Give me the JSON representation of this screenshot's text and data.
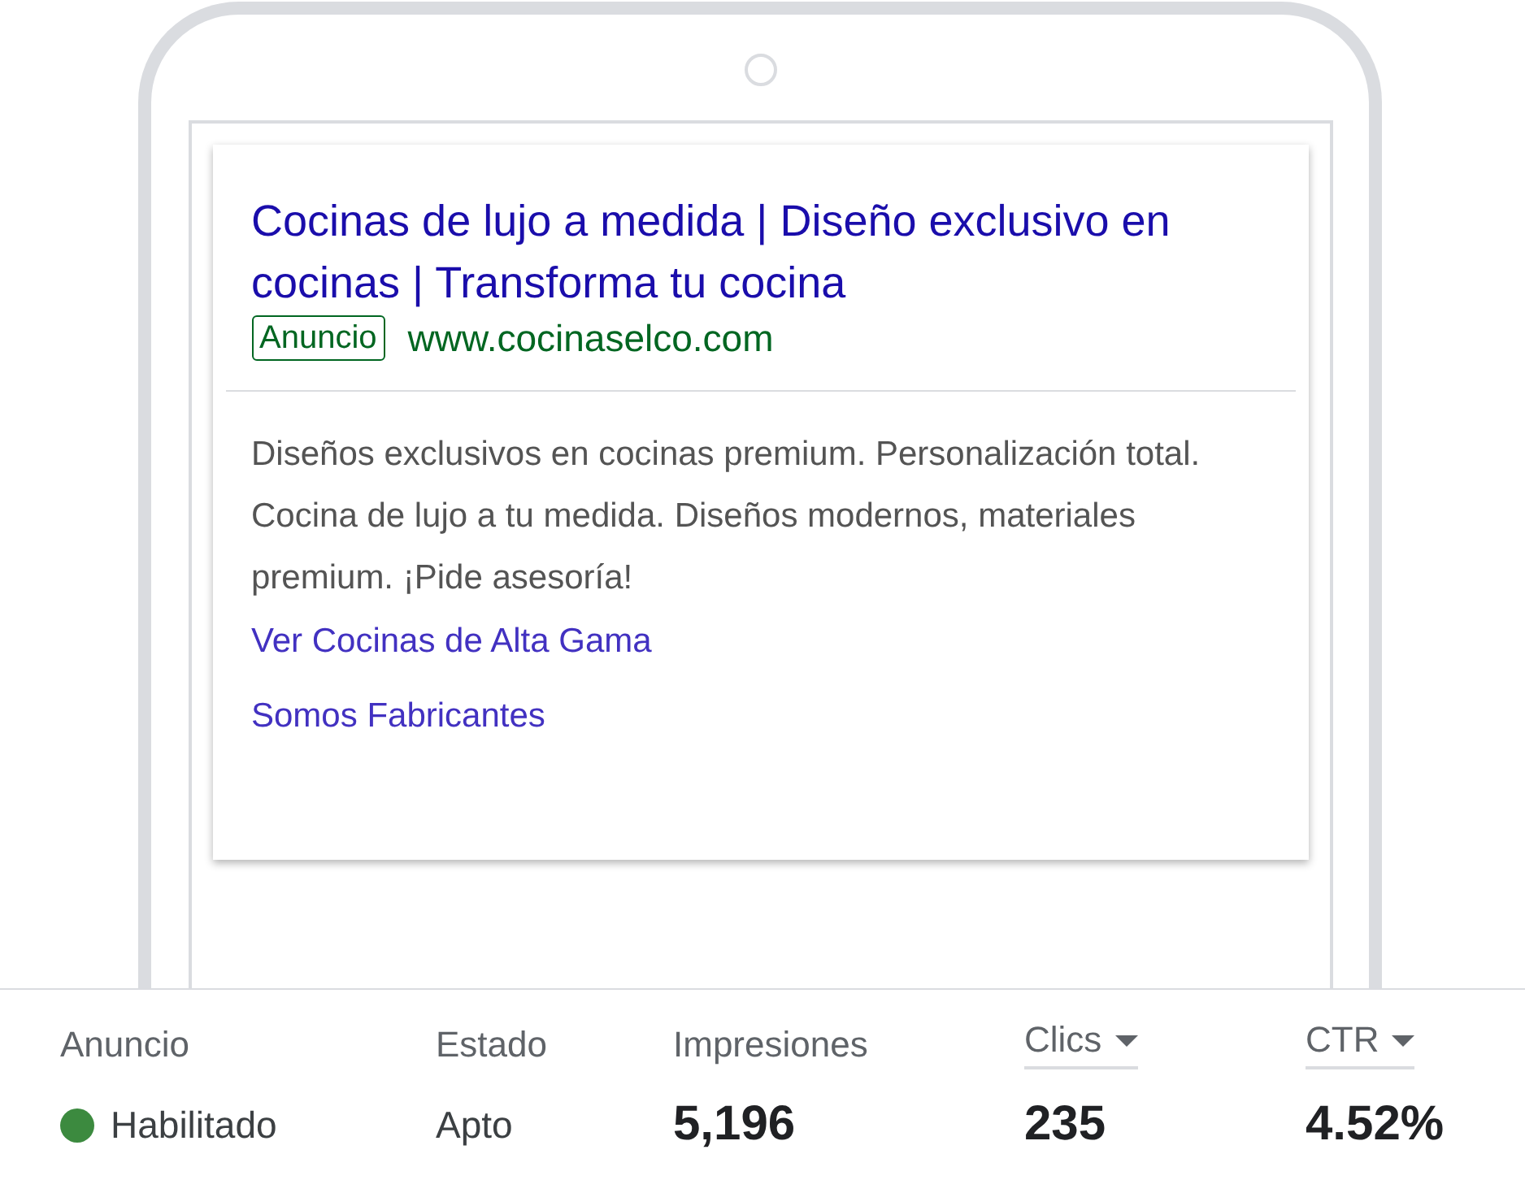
{
  "ad_preview": {
    "headline": "Cocinas de lujo a medida | Diseño exclusivo en cocinas | Transforma tu cocina",
    "badge": "Anuncio",
    "display_url": "www.cocinaselco.com",
    "description": "Diseños exclusivos en cocinas premium. Personalización total. Cocina de lujo a tu medida. Diseños modernos, materiales premium. ¡Pide asesoría!",
    "sitelinks": [
      "Ver Cocinas de Alta Gama",
      "Somos Fabricantes"
    ]
  },
  "table": {
    "columns": [
      {
        "label": "Anuncio",
        "kind": "plain"
      },
      {
        "label": "Estado",
        "kind": "plain"
      },
      {
        "label": "Impresiones",
        "kind": "plain"
      },
      {
        "label": "Clics",
        "kind": "sortable"
      },
      {
        "label": "CTR",
        "kind": "sortable"
      }
    ],
    "row": {
      "status": {
        "label": "Habilitado",
        "color": "#3c8a3f"
      },
      "state": "Apto",
      "impressions": "5,196",
      "clicks": "235",
      "ctr": "4.52%"
    }
  }
}
